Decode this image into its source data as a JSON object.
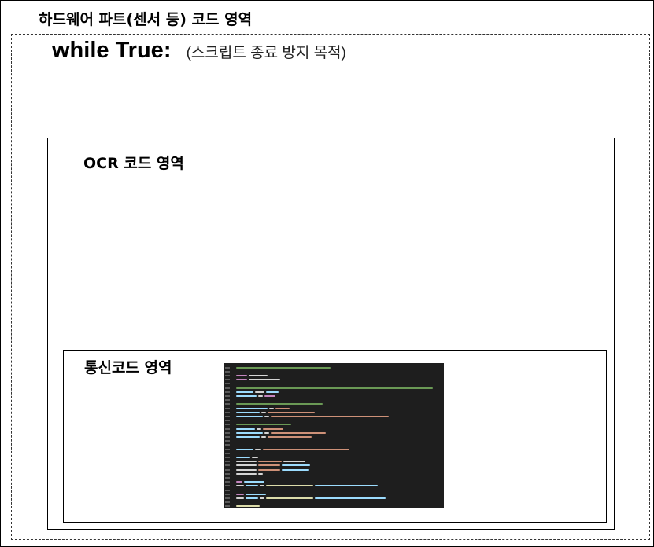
{
  "hardware_section": {
    "title": "하드웨어 파트(센서 등) 코드 영역"
  },
  "loop": {
    "keyword": "while True:",
    "note": "(스크립트 종료 방지 목적)"
  },
  "ocr_section": {
    "title": "OCR 코드 영역"
  },
  "comm_section": {
    "title": "통신코드 영역"
  },
  "code_thumbnail": {
    "background": "#1e1e1e",
    "colors": {
      "comment": "#6a9955",
      "keyword": "#c586c0",
      "identifier": "#9cdcfe",
      "string": "#ce9178",
      "plain": "#d4d4d4",
      "function": "#dcdcaa"
    }
  }
}
